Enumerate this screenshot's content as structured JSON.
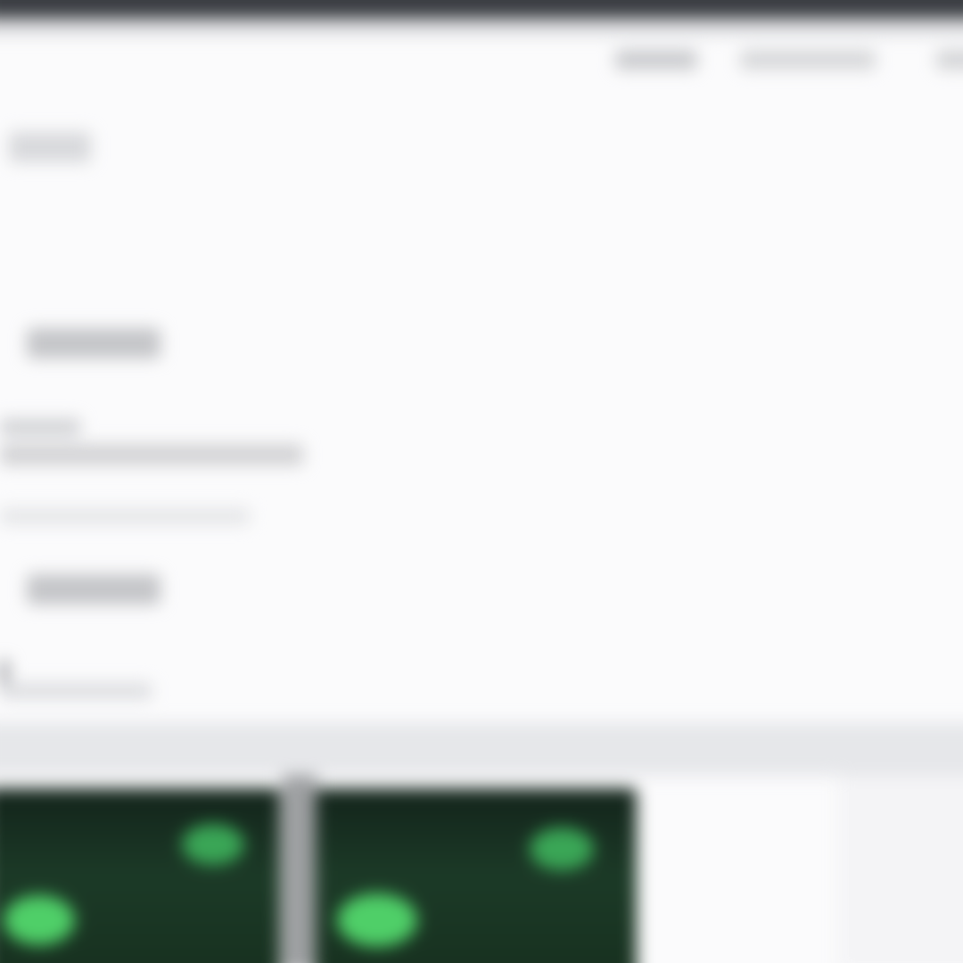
{
  "screen": {
    "state": "out-of-focus",
    "legible_text": []
  },
  "header": {
    "nav_items": [
      "",
      "",
      ""
    ]
  },
  "colors": {
    "top_bar": "#3a3d42",
    "page_background": "#fbfbfc",
    "thumbnail_dark_green": "#17301f",
    "thumbnail_glow": "#4fcf68"
  },
  "content": {
    "buttons": [
      "",
      ""
    ],
    "thumbnails": [
      {
        "icon": "green-glow-thumbnail"
      },
      {
        "icon": "green-glow-thumbnail"
      }
    ]
  }
}
